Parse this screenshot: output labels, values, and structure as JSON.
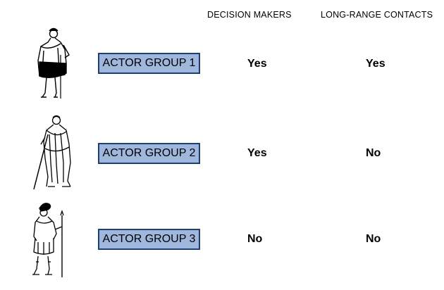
{
  "headers": {
    "decision_makers": "DECISION MAKERS",
    "long_range_contacts": "LONG-RANGE CONTACTS"
  },
  "rows": [
    {
      "actor": "ACTOR GROUP 1",
      "decision_makers": "Yes",
      "long_range_contacts": "Yes",
      "figure_icon": "greek-figure-cloak-icon"
    },
    {
      "actor": "ACTOR GROUP 2",
      "decision_makers": "Yes",
      "long_range_contacts": "No",
      "figure_icon": "greek-figure-staff-icon"
    },
    {
      "actor": "ACTOR GROUP 3",
      "decision_makers": "No",
      "long_range_contacts": "No",
      "figure_icon": "greek-figure-helmet-icon"
    }
  ],
  "colors": {
    "actor_box_fill": "#9fb6dd",
    "actor_box_border": "#1f3f73"
  }
}
